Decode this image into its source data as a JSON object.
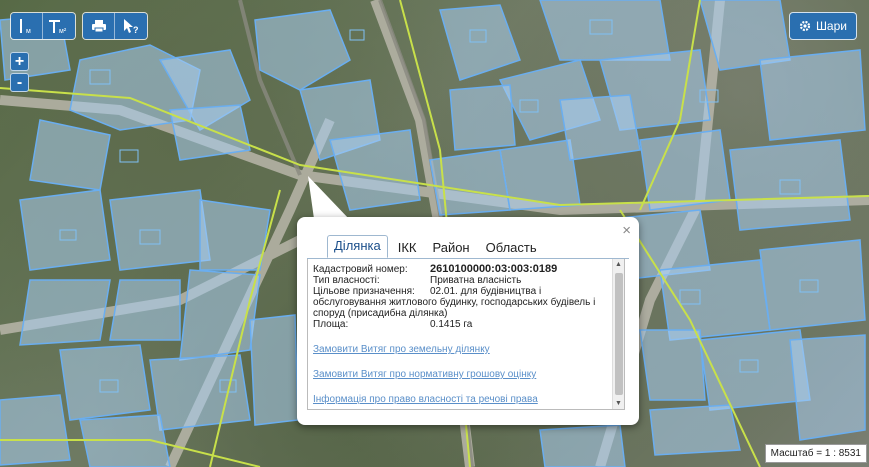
{
  "toolbar": {
    "measure_length_icon": "ruler-line-icon",
    "measure_area_icon": "ruler-area-icon",
    "measure_length_sub": "м",
    "measure_area_sub": "м²",
    "print_icon": "printer-icon",
    "identify_icon": "cursor-question-icon"
  },
  "zoom": {
    "in": "+",
    "out": "-"
  },
  "layers": {
    "label": "Шари",
    "icon": "gear-icon"
  },
  "popup": {
    "tabs": [
      "Ділянка",
      "ІКК",
      "Район",
      "Область"
    ],
    "active_tab": "Ділянка",
    "fields": {
      "cadastral_label": "Кадастровий номер:",
      "cadastral_value": "2610100000:03:003:0189",
      "ownership_label": "Тип власності:",
      "ownership_value": "Приватна власність",
      "purpose_label": "Цільове призначення:",
      "purpose_value_line1": "02.01. для будівництва і",
      "purpose_value_rest": "обслуговування житлового будинку, господарських будівель і споруд (присадибна ділянка)",
      "area_label": "Площа:",
      "area_value": "0.1415 га"
    },
    "links": [
      "Замовити Витяг про земельну ділянку",
      "Замовити Витяг про нормативну грошову оцінку",
      "Інформація про право власності та речові права"
    ],
    "close": "×"
  },
  "scale": {
    "text": "Масштаб = 1 : 8531"
  },
  "colors": {
    "parcel_fill": "#a9cdf0",
    "parcel_stroke": "#6aaef0",
    "road": "#c8e04a",
    "button_blue": "#2a6fb0"
  }
}
